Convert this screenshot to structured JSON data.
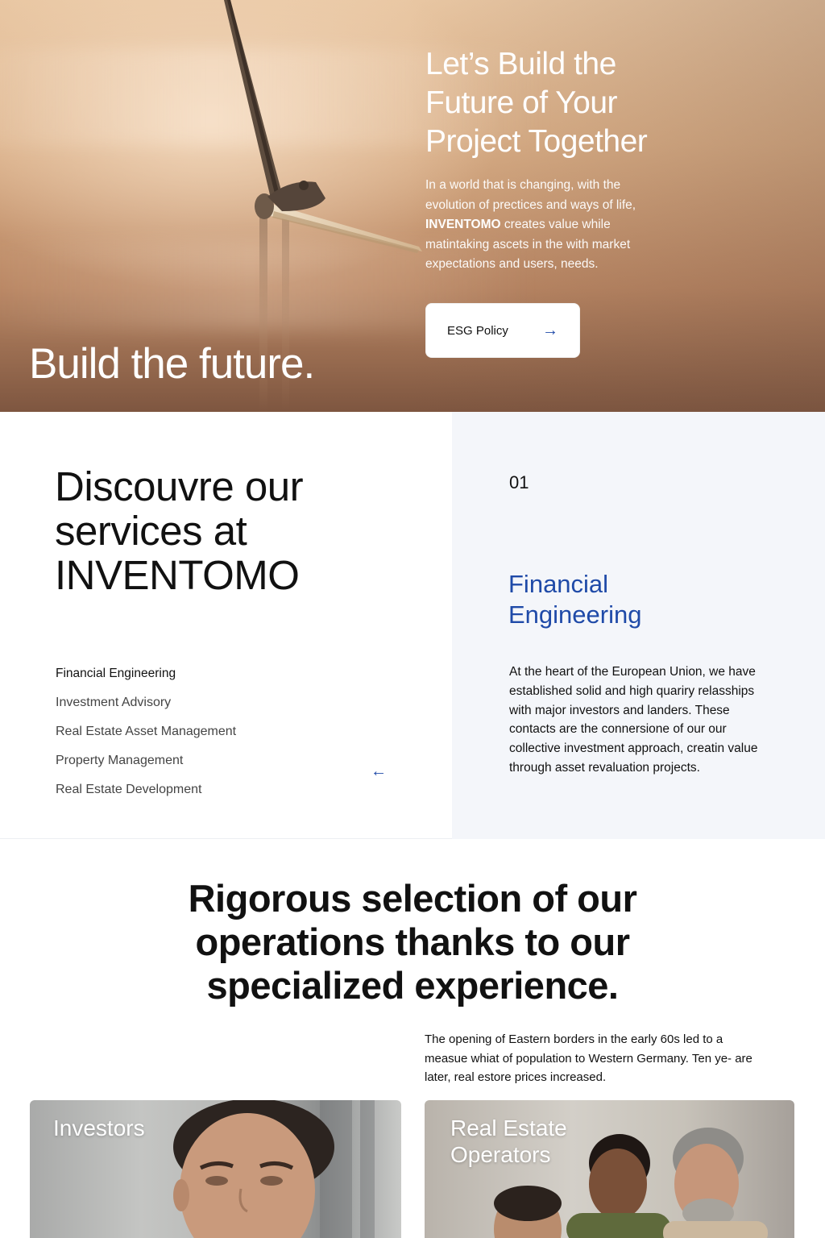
{
  "hero": {
    "title": "Let’s Build the Future of Your Project Together",
    "text_line1": "In a world that is changing, with the evolution of prectices and ways of life,",
    "brand": "INVENTOMO",
    "text_line2": "creates value while matintaking ascets in the with market expectations and users, needs.",
    "button_label": "ESG Policy",
    "button_icon": "arrow-right-icon",
    "tagline": "Build the future."
  },
  "services": {
    "title": "Discouvre our services at INVENTOMO",
    "items": [
      "Financial Engineering",
      "Investment Advisory",
      "Real Estate Asset Management",
      "Property Management",
      "Real Estate Development"
    ],
    "active_index": 0,
    "back_icon": "arrow-left-icon",
    "detail": {
      "number": "01",
      "heading": "Financial Engineering",
      "description": "At the heart of the European Union, we have established solid and high quariry relasships with major investors and landers. These contacts are the connersione of our our collective investment approach, creatin value through asset revaluation projects."
    }
  },
  "selection": {
    "title": "Rigorous selection of our operations thanks to our specialized experience.",
    "text": "The opening of Eastern borders in the early 60s led to a measue whiat of population to Western Germany. Ten ye- are later, real estore prices increased."
  },
  "cards": [
    {
      "label": "Investors"
    },
    {
      "label": "Real Estate Operators"
    }
  ],
  "colors": {
    "accent": "#1f4aa8",
    "panel": "#f4f6fa",
    "text": "#111111"
  }
}
